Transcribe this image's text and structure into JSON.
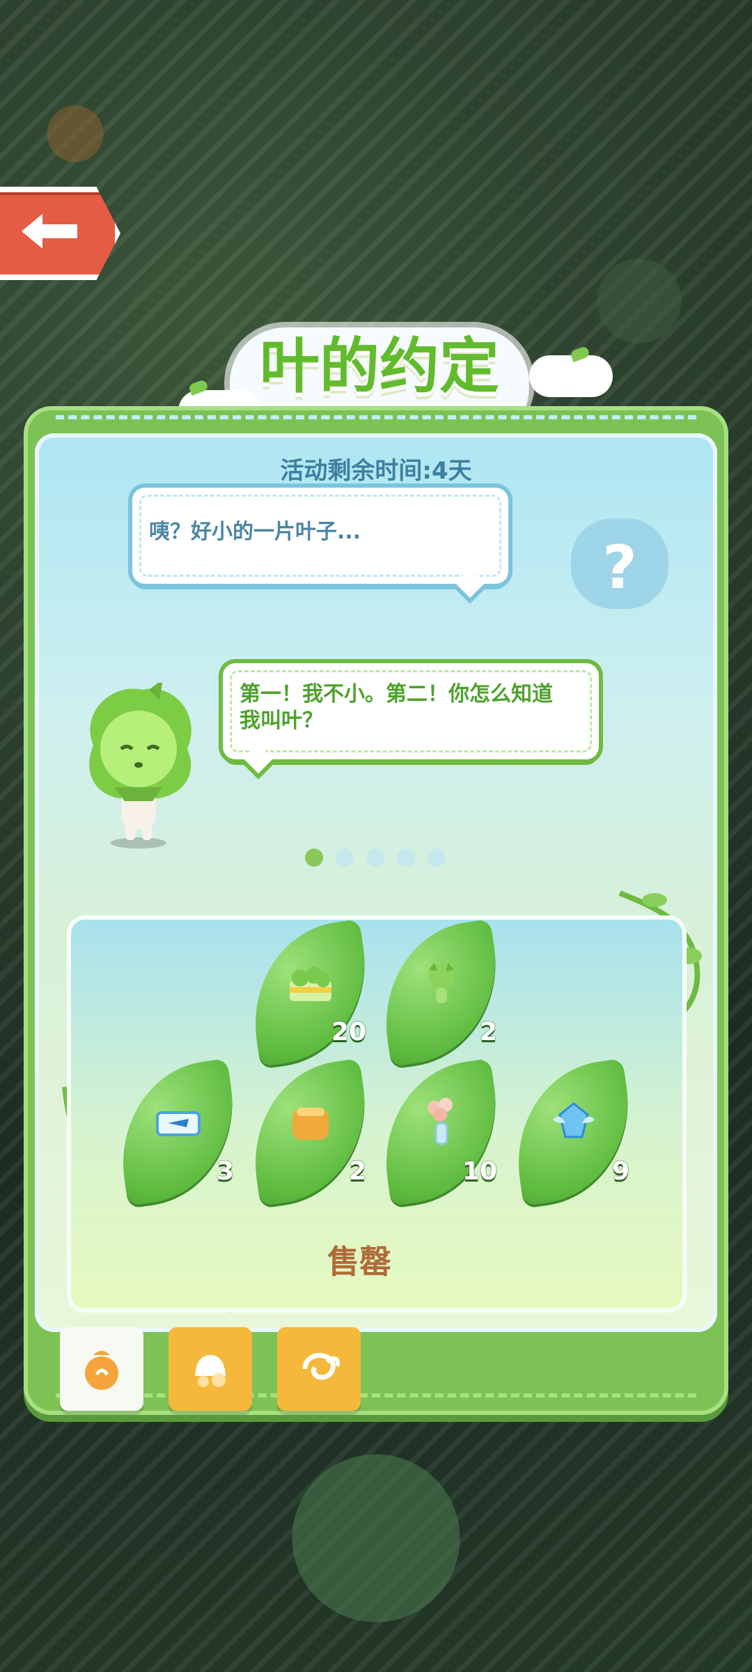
{
  "header": {
    "title": "叶的约定",
    "remaining_time": "活动剩余时间:4天"
  },
  "dialogue": {
    "bubble1": "咦？好小的一片叶子...",
    "bubble2_line1": "第一！我不小。第二！你怎么知道",
    "bubble2_line2": "我叫叶？"
  },
  "pager": {
    "total": 5,
    "active_index": 0
  },
  "rewards": [
    {
      "icon": "green-chick-cake-icon",
      "count": "20"
    },
    {
      "icon": "green-fairy-icon",
      "count": "2"
    },
    {
      "icon": "ticket-icon",
      "count": "3"
    },
    {
      "icon": "orange-bag-icon",
      "count": "2"
    },
    {
      "icon": "flower-vase-icon",
      "count": "10"
    },
    {
      "icon": "blue-crystal-icon",
      "count": "9"
    }
  ],
  "labels": {
    "sale": "售罄"
  },
  "tabs": [
    {
      "name": "bag-tab",
      "state": "active",
      "icon": "money-bag-icon"
    },
    {
      "name": "coins-tab",
      "state": "inactive",
      "icon": "coins-icon"
    },
    {
      "name": "wings-tab",
      "state": "inactive",
      "icon": "spiral-icon"
    }
  ],
  "colors": {
    "title": "#62bb2d",
    "panel": "#7dc254",
    "back_button": "#e35c43",
    "tab_inactive": "#f5b83a"
  }
}
